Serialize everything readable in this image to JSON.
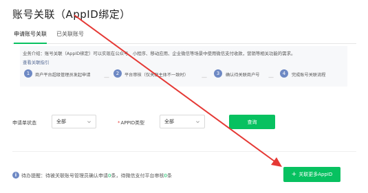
{
  "page": {
    "title": "账号关联（AppID绑定）"
  },
  "tabs": [
    {
      "label": "申请账号关联",
      "active": true
    },
    {
      "label": "已关联账号",
      "active": false
    }
  ],
  "intro": {
    "text": "业务介绍：账号关联（AppID绑定）可以实现在公众号、小程序、移动应用、企业微信等场景中使用微信支付收款，营销等相关功能的需求。",
    "link": "查看关联指引"
  },
  "steps": [
    {
      "num": "1",
      "label": "商户平台超级管理员发起申请"
    },
    {
      "num": "2",
      "label": "平台审核（仅关联主体不一致时）"
    },
    {
      "num": "3",
      "label": "确认待关联商户号"
    },
    {
      "num": "4",
      "label": "完成账号关联流程"
    }
  ],
  "filters": {
    "status_label": "申请单状态",
    "status_value": "全部",
    "appid_required_mark": "*",
    "appid_label": "APPID类型",
    "appid_value": "全部",
    "query_button": "查询"
  },
  "notice": {
    "icon": "info-icon",
    "prefix": "待办提醒：待被关联账号管理员确认申请",
    "count1": "0",
    "middle": "条，待微信支付平台审核",
    "count2": "0",
    "suffix": "条"
  },
  "actions": {
    "add_plus": "+",
    "add_label": "关联更多AppID"
  },
  "colors": {
    "accent": "#07c160",
    "step": "#6e89c4",
    "annotation_arrow": "#e53935"
  }
}
